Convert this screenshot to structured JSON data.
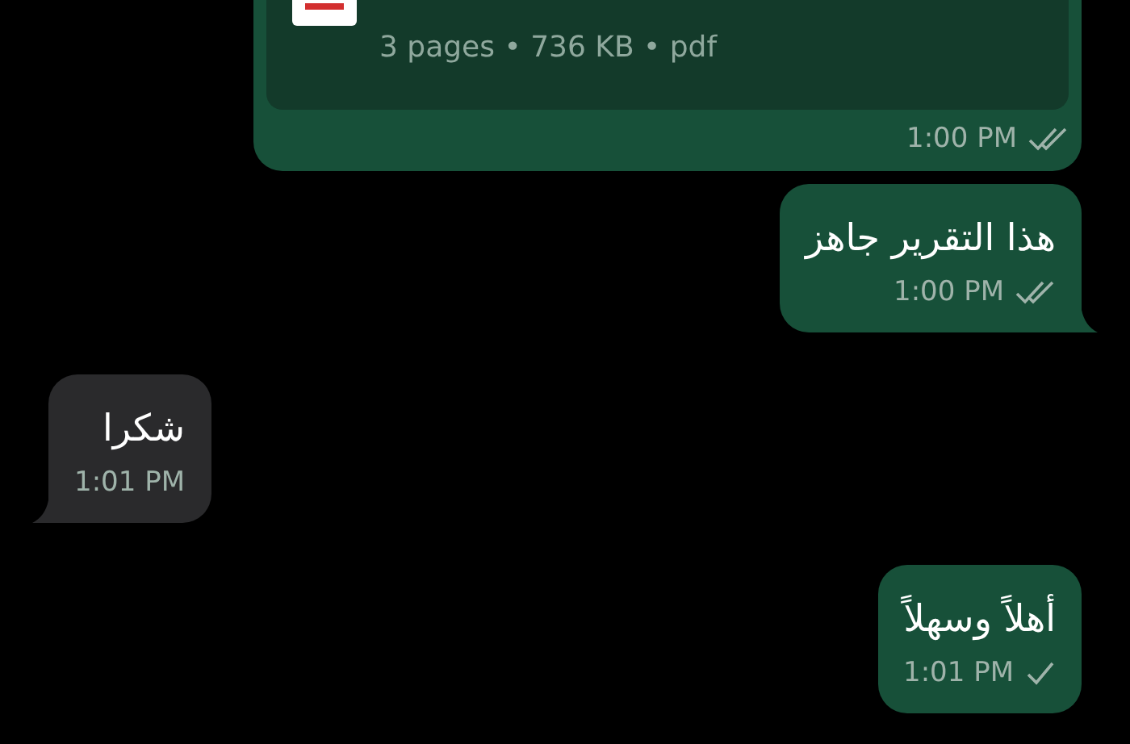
{
  "messages": [
    {
      "kind": "document",
      "outgoing": true,
      "meta": "3 pages • 736 KB • pdf",
      "time": "1:00 PM",
      "read": true,
      "tail": false
    },
    {
      "kind": "text",
      "outgoing": true,
      "text": "هذا التقرير جاهز",
      "time": "1:00 PM",
      "read": true,
      "tail": true
    },
    {
      "kind": "text",
      "outgoing": false,
      "text": "شكرا",
      "time": "1:01 PM",
      "tail": true
    },
    {
      "kind": "text",
      "outgoing": true,
      "text": "أهلاً وسهلاً",
      "time": "1:01 PM",
      "read": false,
      "tail": false
    }
  ]
}
